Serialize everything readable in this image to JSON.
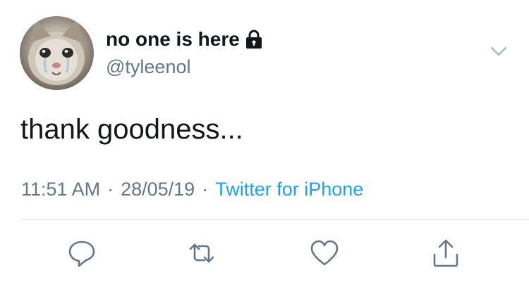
{
  "user": {
    "display_name": "no one is here",
    "handle": "@tyleenol",
    "avatar_icon": "crying-cat-avatar",
    "protected_icon": "lock-icon"
  },
  "tweet": {
    "text": "thank goodness...",
    "time": "11:51 AM",
    "separator": "·",
    "date": "28/05/19",
    "source": "Twitter for iPhone"
  },
  "actions": [
    {
      "name": "reply",
      "icon": "reply-icon"
    },
    {
      "name": "retweet",
      "icon": "retweet-icon"
    },
    {
      "name": "like",
      "icon": "heart-icon"
    },
    {
      "name": "share",
      "icon": "share-icon"
    }
  ],
  "colors": {
    "text": "#14171a",
    "secondary": "#657786",
    "link": "#1da1f2",
    "divider": "#dbe1e6"
  }
}
